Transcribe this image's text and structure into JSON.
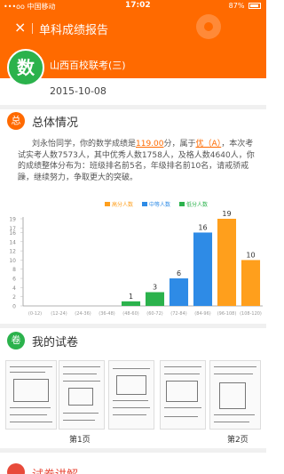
{
  "statusbar": {
    "carrier": "•••oo 中国移动",
    "time": "17:02",
    "battery": "87%"
  },
  "titlebar": {
    "close": "×",
    "title": "单科成绩报告"
  },
  "exam": {
    "badge": "数",
    "name": "山西百校联考(三)",
    "date": "2015-10-08"
  },
  "section1": {
    "icon": "总",
    "title": "总体情况",
    "color": "#ff6a00"
  },
  "summary": {
    "t1": "刘永怡同学，你的数学成绩是",
    "score": "119.00",
    "t2": "分，属于",
    "level": "优（A）",
    "t3": "，本次考试实考人数7573人，其中优秀人数1758人，及格人数4640人，你的成绩整体分布为：班级排名前5名，年级排名前10名，请戒骄戒躁，继续努力，争取更大的突破。"
  },
  "chart_data": {
    "type": "bar",
    "categories": [
      "(0-12)",
      "(12-24)",
      "(24-36)",
      "(36-48)",
      "(48-60)",
      "(60-72)",
      "(72-84)",
      "(84-96)",
      "(96-108)",
      "(108-120)"
    ],
    "values": [
      0,
      0,
      0,
      0,
      1,
      3,
      6,
      16,
      19,
      10
    ],
    "colors": [
      "#2bb24c",
      "#2bb24c",
      "#2bb24c",
      "#2bb24c",
      "#2bb24c",
      "#2bb24c",
      "#2e8be6",
      "#2e8be6",
      "#ff9f1c",
      "#ff9f1c"
    ],
    "ylim": [
      0,
      19
    ],
    "yticks": [
      0,
      2,
      4,
      6,
      8,
      10,
      12,
      14,
      16,
      17,
      19
    ],
    "legend": [
      {
        "name": "高分人数",
        "color": "#ff9f1c"
      },
      {
        "name": "中等人数",
        "color": "#2e8be6"
      },
      {
        "name": "低分人数",
        "color": "#2bb24c"
      }
    ],
    "legend_position": "top-right"
  },
  "section2": {
    "icon": "卷",
    "title": "我的试卷",
    "color": "#2bb24c"
  },
  "papers": {
    "page1": "第1页",
    "page2": "第2页"
  },
  "section3": {
    "title": "试卷讲解"
  }
}
